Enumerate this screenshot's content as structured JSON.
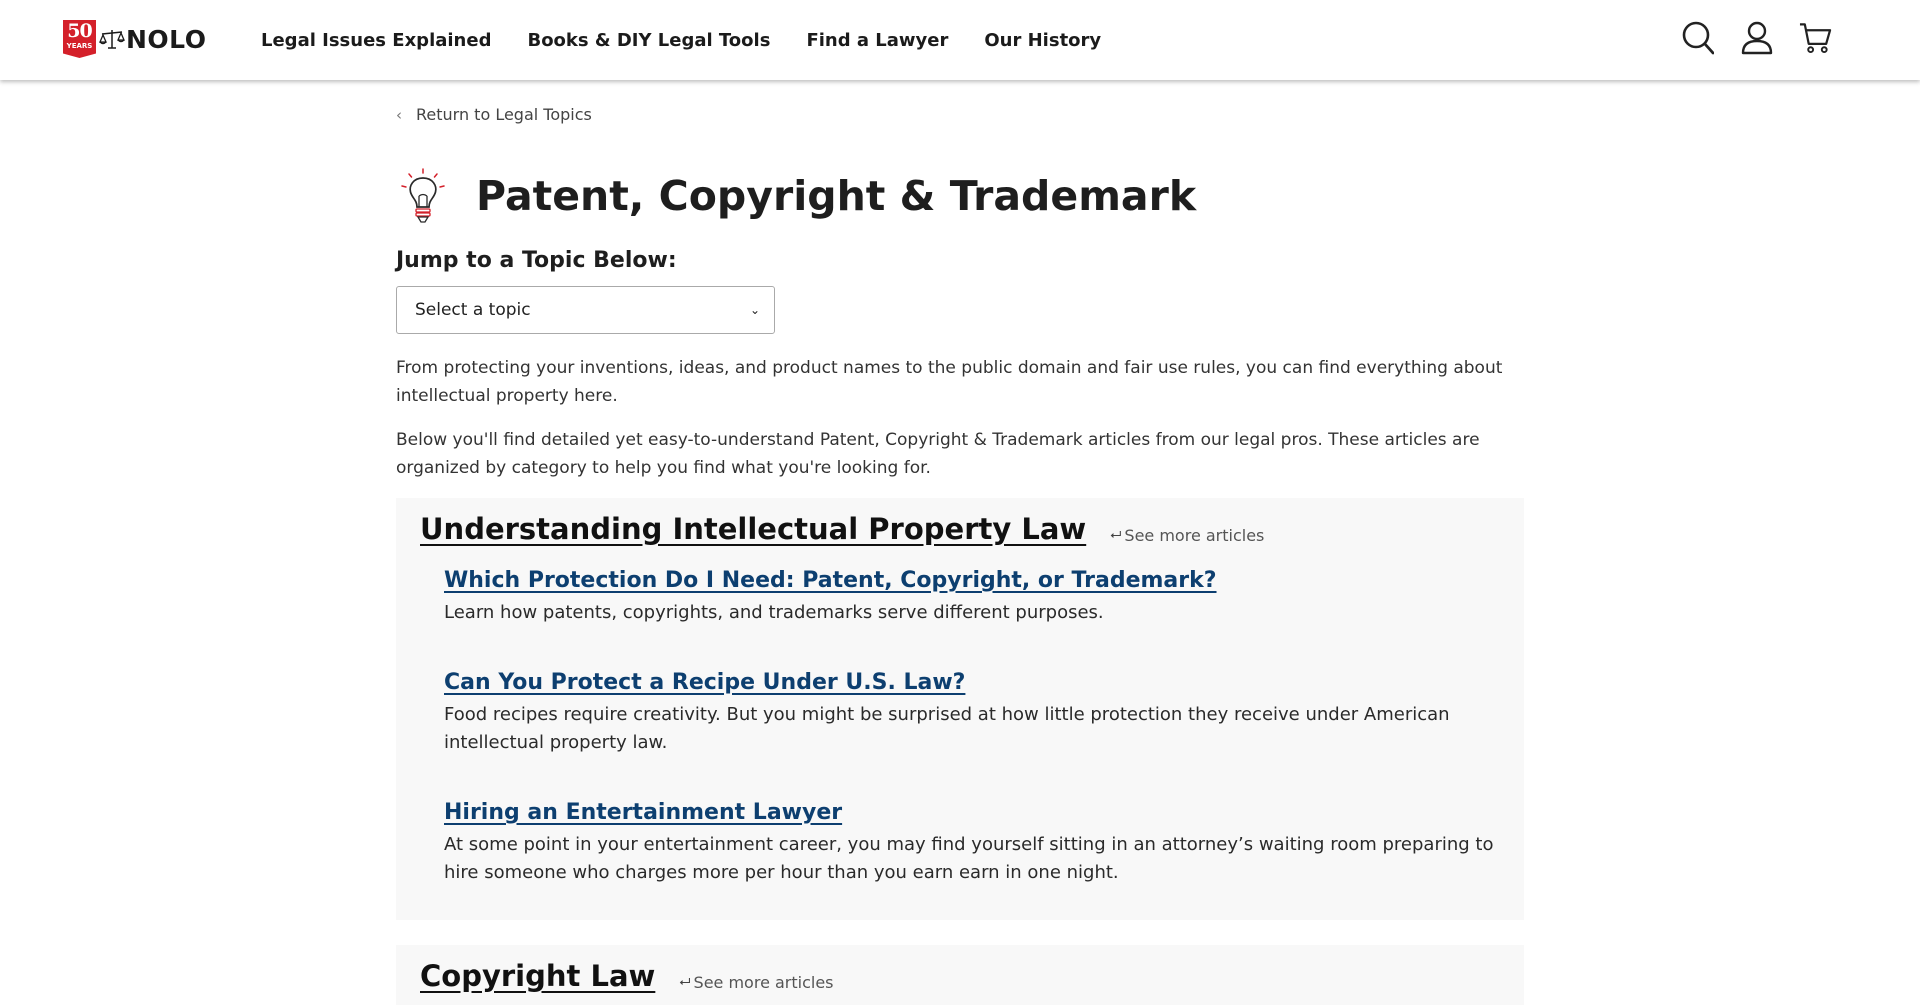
{
  "header": {
    "logo": {
      "badge_number": "50",
      "badge_text": "YEARS",
      "brand": "NOLO"
    },
    "nav": [
      {
        "label": "Legal Issues Explained"
      },
      {
        "label": "Books & DIY Legal Tools"
      },
      {
        "label": "Find a Lawyer"
      },
      {
        "label": "Our History"
      }
    ],
    "icons": [
      "search-icon",
      "account-icon",
      "cart-icon"
    ]
  },
  "breadcrumb": {
    "back_label": "Return to Legal Topics"
  },
  "page": {
    "title": "Patent, Copyright & Trademark",
    "icon": "lightbulb-icon",
    "jump_label": "Jump to a Topic Below:",
    "select_value": "Select a topic",
    "intro_1": "From protecting your inventions, ideas, and product names to the public domain and fair use rules, you can find everything about intellectual property here.",
    "intro_2": "Below you'll find detailed yet easy-to-understand Patent, Copyright & Trademark articles from our legal pros. These articles are organized by category to help you find what you're looking for."
  },
  "sections": [
    {
      "title": "Understanding Intellectual Property Law",
      "see_more": "See more articles",
      "articles": [
        {
          "title": "Which Protection Do I Need: Patent, Copyright, or Trademark?",
          "desc": "Learn how patents, copyrights, and trademarks serve different purposes."
        },
        {
          "title": "Can You Protect a Recipe Under U.S. Law?",
          "desc": "Food recipes require creativity. But you might be surprised at how little protection they receive under American intellectual property law."
        },
        {
          "title": "Hiring an Entertainment Lawyer",
          "desc": "At some point in your entertainment career, you may find yourself sitting in an attorney’s waiting room preparing to hire someone who charges more per hour than you earn earn in one night."
        }
      ]
    },
    {
      "title": "Copyright Law",
      "see_more": "See more articles"
    }
  ],
  "colors": {
    "accent_red": "#d4202a",
    "link_blue": "#0d3f70",
    "section_bg": "#f8f8f8"
  }
}
